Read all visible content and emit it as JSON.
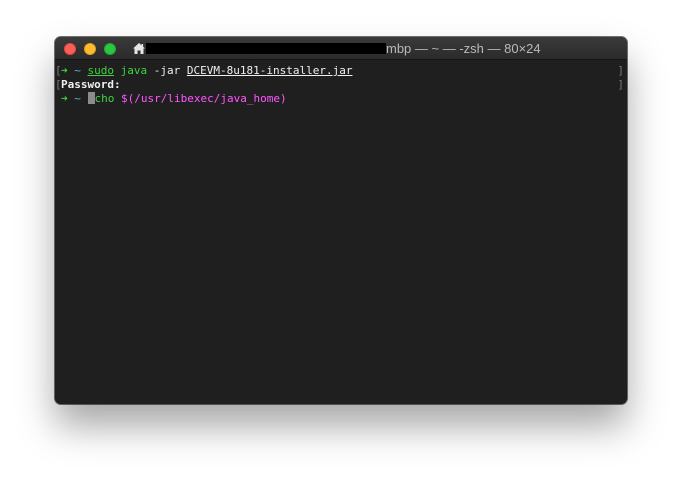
{
  "window": {
    "title_suffix": "mbp — ~ — -zsh — 80×24",
    "title_redacted": true
  },
  "terminal": {
    "line1": {
      "prompt_arrow": "➜",
      "prompt_dir": "~",
      "cmd_sudo": "sudo",
      "cmd_java": "java",
      "arg_jar": "-jar",
      "arg_file": "DCEVM-8u181-installer.jar",
      "mark_left": "[",
      "mark_right": "]"
    },
    "line2": {
      "text": "Password:",
      "mark_left": "[",
      "mark_right": "]"
    },
    "line3": {
      "prompt_arrow": "➜",
      "prompt_dir": "~",
      "cmd_rest": "cho",
      "dollar": "$",
      "path": "(/usr/libexec/java_home)"
    }
  },
  "colors": {
    "prompt_arrow": "#3fd43f",
    "prompt_dir": "#5cb8d8",
    "command": "#3fd43f",
    "substitution": "#ff58ff",
    "background": "#1f1f1f"
  },
  "icons": {
    "home": "home-icon"
  }
}
